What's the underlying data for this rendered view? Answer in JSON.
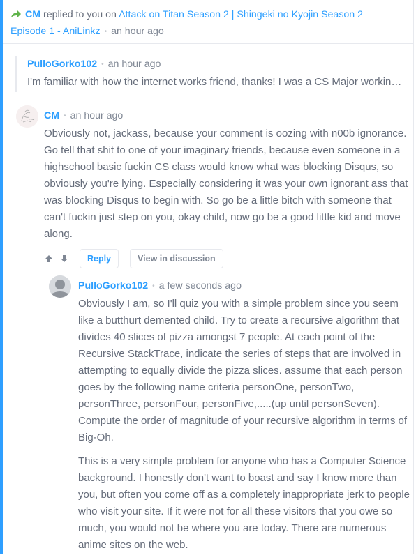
{
  "notification": {
    "icon": "reply-arrow-icon",
    "actor": "CM",
    "action_text": " replied to you on ",
    "thread_title": "Attack on Titan Season 2 | Shingeki no Kyojin Season 2 Episode 1 - AniLinkz",
    "timestamp": "an hour ago"
  },
  "quoted_comment": {
    "author": "PulloGorko102",
    "timestamp": "an hour ago",
    "excerpt": "I'm familiar with how the internet works friend, thanks! I was a CS Major working..."
  },
  "comment": {
    "author": "CM",
    "timestamp": "an hour ago",
    "avatar": "user-avatar-sketch",
    "paragraphs": [
      "Obviously not, jackass, because your comment is oozing with n00b ignorance. Go tell that shit to one of your imaginary friends, because even someone in a highschool basic fuckin CS class would know what was blocking Disqus, so obviously you're lying. Especially considering it was your own ignorant ass that was blocking Disqus to begin with. So go be a little bitch with someone that can't fuckin just step on you, okay child, now go be a good little kid and move along."
    ],
    "actions": {
      "upvote_icon": "arrow-up-icon",
      "downvote_icon": "arrow-down-icon",
      "reply_label": "Reply",
      "view_label": "View in discussion"
    }
  },
  "reply": {
    "author": "PulloGorko102",
    "timestamp": "a few seconds ago",
    "avatar": "default-avatar",
    "paragraphs": [
      "Obviously I am, so I'll quiz you with a simple problem since you seem like a butthurt demented child. Try to create a recursive algorithm that divides 40 slices of pizza amongst 7 people. At each point of the Recursive StackTrace, indicate the series of steps that are involved in attempting to equally divide the pizza slices. assume that each person goes by the following name criteria personOne, personTwo, personThree, personFour, personFive,.....(up until personSeven). Compute the order of magnitude of your recursive algorithm in terms of Big-Oh.",
      "This is a very simple problem for anyone who has a Computer Science background. I honestly don't want to boast and say I know more than you, but often you come off as a completely inappropriate jerk to people who visit your site. If it were not for all these visitors that you owe so much, you would not be where you are today. There are numerous anime sites on the web."
    ]
  },
  "colors": {
    "accent": "#2e9fff",
    "text": "#656c7a",
    "muted": "#7f8794",
    "border": "#e7e9ee",
    "reply_icon": "#5fb34a"
  }
}
